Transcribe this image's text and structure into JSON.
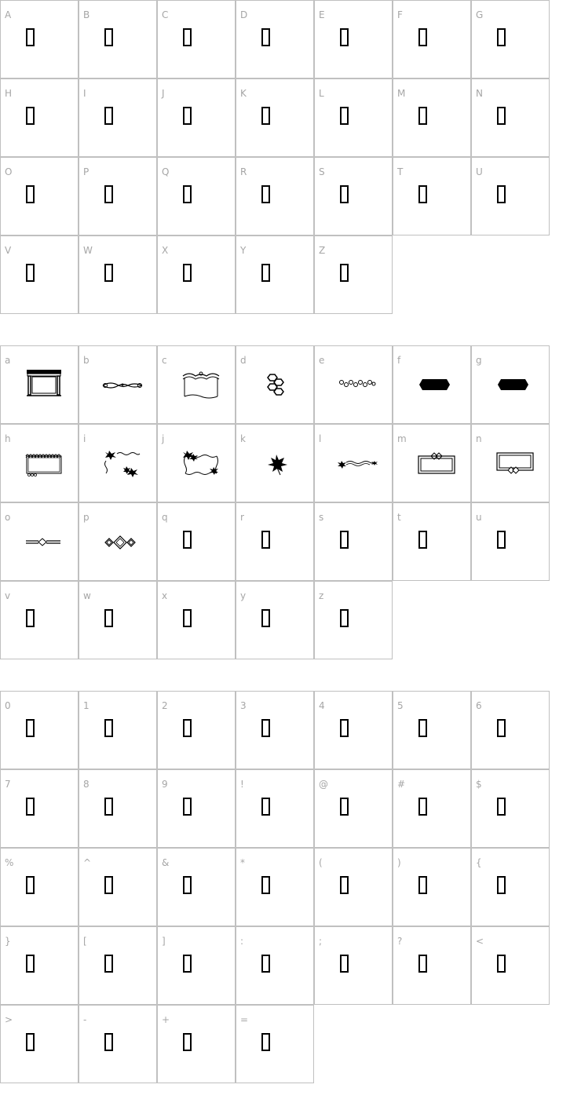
{
  "sections": [
    {
      "id": "uppercase",
      "cells": [
        {
          "label": "A",
          "glyph": "missing"
        },
        {
          "label": "B",
          "glyph": "missing"
        },
        {
          "label": "C",
          "glyph": "missing"
        },
        {
          "label": "D",
          "glyph": "missing"
        },
        {
          "label": "E",
          "glyph": "missing"
        },
        {
          "label": "F",
          "glyph": "missing"
        },
        {
          "label": "G",
          "glyph": "missing"
        },
        {
          "label": "H",
          "glyph": "missing"
        },
        {
          "label": "I",
          "glyph": "missing"
        },
        {
          "label": "J",
          "glyph": "missing"
        },
        {
          "label": "K",
          "glyph": "missing"
        },
        {
          "label": "L",
          "glyph": "missing"
        },
        {
          "label": "M",
          "glyph": "missing"
        },
        {
          "label": "N",
          "glyph": "missing"
        },
        {
          "label": "O",
          "glyph": "missing"
        },
        {
          "label": "P",
          "glyph": "missing"
        },
        {
          "label": "Q",
          "glyph": "missing"
        },
        {
          "label": "R",
          "glyph": "missing"
        },
        {
          "label": "S",
          "glyph": "missing"
        },
        {
          "label": "T",
          "glyph": "missing"
        },
        {
          "label": "U",
          "glyph": "missing"
        },
        {
          "label": "V",
          "glyph": "missing"
        },
        {
          "label": "W",
          "glyph": "missing"
        },
        {
          "label": "X",
          "glyph": "missing"
        },
        {
          "label": "Y",
          "glyph": "missing"
        },
        {
          "label": "Z",
          "glyph": "missing"
        }
      ]
    },
    {
      "id": "lowercase",
      "cells": [
        {
          "label": "a",
          "glyph": "pillared-frame"
        },
        {
          "label": "b",
          "glyph": "scroll-flourish"
        },
        {
          "label": "c",
          "glyph": "scroll-banner"
        },
        {
          "label": "d",
          "glyph": "honeycomb"
        },
        {
          "label": "e",
          "glyph": "bead-chain"
        },
        {
          "label": "f",
          "glyph": "hexagon-bar"
        },
        {
          "label": "g",
          "glyph": "hexagon-bar"
        },
        {
          "label": "h",
          "glyph": "scalloped-frame"
        },
        {
          "label": "i",
          "glyph": "leaf-corners"
        },
        {
          "label": "j",
          "glyph": "leaf-frame"
        },
        {
          "label": "k",
          "glyph": "maple-leaf"
        },
        {
          "label": "l",
          "glyph": "leaf-vine"
        },
        {
          "label": "m",
          "glyph": "diamond-top-frame"
        },
        {
          "label": "n",
          "glyph": "diamond-bottom-frame"
        },
        {
          "label": "o",
          "glyph": "diamond-rule"
        },
        {
          "label": "p",
          "glyph": "triple-diamond"
        },
        {
          "label": "q",
          "glyph": "missing"
        },
        {
          "label": "r",
          "glyph": "missing"
        },
        {
          "label": "s",
          "glyph": "missing"
        },
        {
          "label": "t",
          "glyph": "missing"
        },
        {
          "label": "u",
          "glyph": "missing"
        },
        {
          "label": "v",
          "glyph": "missing"
        },
        {
          "label": "w",
          "glyph": "missing"
        },
        {
          "label": "x",
          "glyph": "missing"
        },
        {
          "label": "y",
          "glyph": "missing"
        },
        {
          "label": "z",
          "glyph": "missing"
        }
      ]
    },
    {
      "id": "digits-symbols",
      "cells": [
        {
          "label": "0",
          "glyph": "missing"
        },
        {
          "label": "1",
          "glyph": "missing"
        },
        {
          "label": "2",
          "glyph": "missing"
        },
        {
          "label": "3",
          "glyph": "missing"
        },
        {
          "label": "4",
          "glyph": "missing"
        },
        {
          "label": "5",
          "glyph": "missing"
        },
        {
          "label": "6",
          "glyph": "missing"
        },
        {
          "label": "7",
          "glyph": "missing"
        },
        {
          "label": "8",
          "glyph": "missing"
        },
        {
          "label": "9",
          "glyph": "missing"
        },
        {
          "label": "!",
          "glyph": "missing"
        },
        {
          "label": "@",
          "glyph": "missing"
        },
        {
          "label": "#",
          "glyph": "missing"
        },
        {
          "label": "$",
          "glyph": "missing"
        },
        {
          "label": "%",
          "glyph": "missing"
        },
        {
          "label": "^",
          "glyph": "missing"
        },
        {
          "label": "&",
          "glyph": "missing"
        },
        {
          "label": "*",
          "glyph": "missing"
        },
        {
          "label": "(",
          "glyph": "missing"
        },
        {
          "label": ")",
          "glyph": "missing"
        },
        {
          "label": "{",
          "glyph": "missing"
        },
        {
          "label": "}",
          "glyph": "missing"
        },
        {
          "label": "[",
          "glyph": "missing"
        },
        {
          "label": "]",
          "glyph": "missing"
        },
        {
          "label": ":",
          "glyph": "missing"
        },
        {
          "label": ";",
          "glyph": "missing"
        },
        {
          "label": "?",
          "glyph": "missing"
        },
        {
          "label": "<",
          "glyph": "missing"
        },
        {
          "label": ">",
          "glyph": "missing"
        },
        {
          "label": "-",
          "glyph": "missing"
        },
        {
          "label": "+",
          "glyph": "missing"
        },
        {
          "label": "=",
          "glyph": "missing"
        }
      ]
    }
  ],
  "colors": {
    "border": "#c0c0c0",
    "label": "#a6a6a6",
    "glyph": "#000000"
  }
}
